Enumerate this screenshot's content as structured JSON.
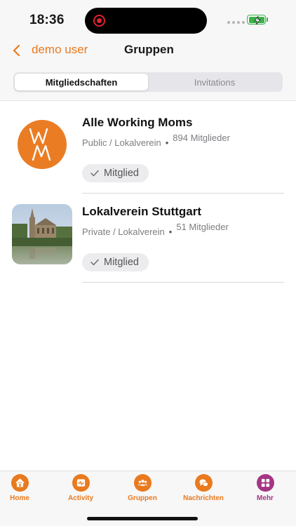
{
  "status_bar": {
    "time": "18:36",
    "battery_color": "#3bb34a"
  },
  "nav": {
    "back_label": "demo user",
    "title": "Gruppen",
    "accent": "#e97a1e"
  },
  "tabs_segment": [
    {
      "label": "Mitgliedschaften",
      "active": true
    },
    {
      "label": "Invitations",
      "active": false
    }
  ],
  "groups": [
    {
      "name": "Alle Working Moms",
      "type": "Public / Lokalverein",
      "members": "894 Mitglieder",
      "badge": "Mitglied",
      "avatar_text": "WM"
    },
    {
      "name": "Lokalverein Stuttgart",
      "type": "Private / Lokalverein",
      "members": "51 Mitglieder",
      "badge": "Mitglied"
    }
  ],
  "tab_bar": {
    "items": [
      {
        "label": "Home",
        "icon": "home-icon"
      },
      {
        "label": "Activity",
        "icon": "activity-icon"
      },
      {
        "label": "Gruppen",
        "icon": "groups-icon"
      },
      {
        "label": "Nachrichten",
        "icon": "messages-icon"
      },
      {
        "label": "Mehr",
        "icon": "grid-icon"
      }
    ],
    "accent": "#e97a1e",
    "mehr_color": "#a43683"
  }
}
